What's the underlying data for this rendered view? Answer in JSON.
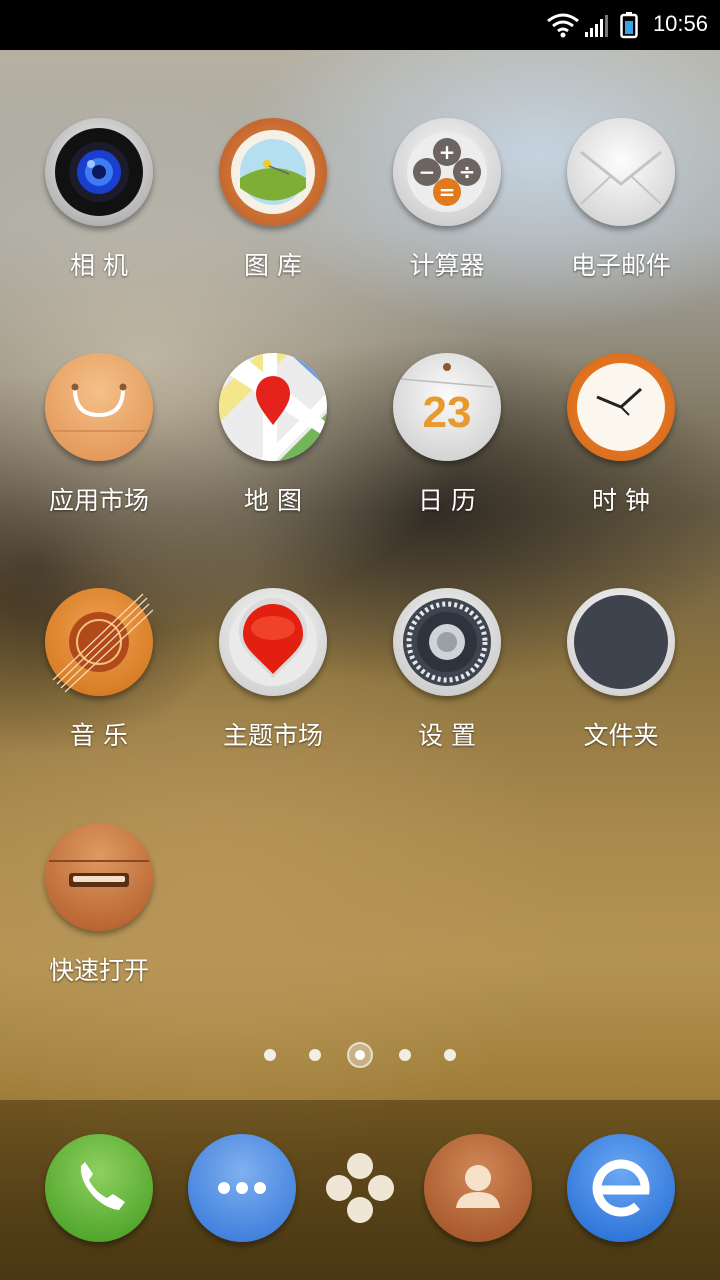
{
  "status_bar": {
    "time": "10:56",
    "icons": [
      "wifi-icon",
      "signal-icon",
      "battery-icon"
    ]
  },
  "apps": [
    {
      "label": "相 机",
      "icon": "camera-icon"
    },
    {
      "label": "图 库",
      "icon": "gallery-icon"
    },
    {
      "label": "计算器",
      "icon": "calculator-icon"
    },
    {
      "label": "电子邮件",
      "icon": "email-icon"
    },
    {
      "label": "应用市场",
      "icon": "app-market-icon"
    },
    {
      "label": "地 图",
      "icon": "map-icon"
    },
    {
      "label": "日 历",
      "icon": "calendar-icon",
      "badge": "23"
    },
    {
      "label": "时 钟",
      "icon": "clock-icon"
    },
    {
      "label": "音 乐",
      "icon": "music-icon"
    },
    {
      "label": "主题市场",
      "icon": "theme-market-icon"
    },
    {
      "label": "设 置",
      "icon": "settings-icon"
    },
    {
      "label": "文件夹",
      "icon": "folder-icon"
    },
    {
      "label": "快速打开",
      "icon": "quick-open-icon"
    }
  ],
  "calculator_symbols": [
    "+",
    "−",
    "÷",
    "="
  ],
  "page_indicator": {
    "count": 5,
    "active_index": 2
  },
  "dock": [
    {
      "icon": "phone-icon"
    },
    {
      "icon": "messages-icon"
    },
    {
      "icon": "app-drawer-icon"
    },
    {
      "icon": "contacts-icon"
    },
    {
      "icon": "browser-icon"
    }
  ]
}
